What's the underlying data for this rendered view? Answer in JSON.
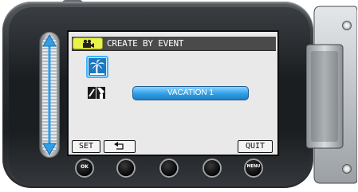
{
  "screen": {
    "title": "CREATE BY EVENT",
    "selected_event": "VACATION 1"
  },
  "icons": {
    "mode_icon": "video-camera-icon",
    "event_icon": "palm-tree-icon",
    "edit_icon": "edit-tag-icon"
  },
  "buttons": {
    "set_label": "SET",
    "return_label": "↶",
    "quit_label": "QUIT"
  },
  "hardware": {
    "ok_label": "OK",
    "menu_label": "MENU"
  },
  "colors": {
    "highlight": "#37b7ff",
    "chip": "#e8f24a",
    "title_bar": "#4a4a4a"
  }
}
